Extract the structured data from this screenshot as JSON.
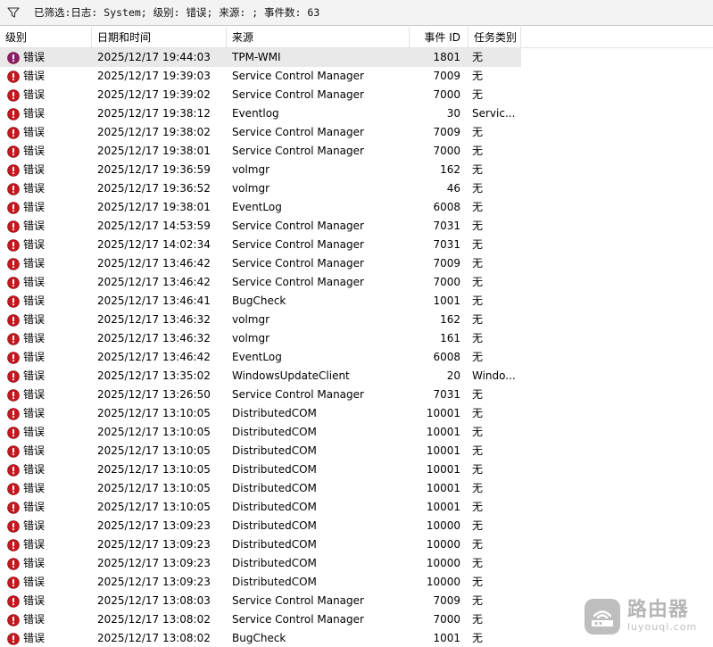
{
  "filter": {
    "text": "已筛选:日志: System; 级别: 错误; 来源: ; 事件数: 63",
    "icon": "filter-funnel-icon"
  },
  "columns": {
    "level": "级别",
    "date": "日期和时间",
    "source": "来源",
    "id": "事件 ID",
    "task": "任务类别"
  },
  "colors": {
    "error": "#c7161d",
    "selected_row": "#e9e9e9"
  },
  "level_label": "错误",
  "rows": [
    {
      "level": "错误",
      "date": "2025/12/17 19:44:03",
      "source": "TPM-WMI",
      "id": "1801",
      "task": "无"
    },
    {
      "level": "错误",
      "date": "2025/12/17 19:39:03",
      "source": "Service Control Manager",
      "id": "7009",
      "task": "无"
    },
    {
      "level": "错误",
      "date": "2025/12/17 19:39:02",
      "source": "Service Control Manager",
      "id": "7000",
      "task": "无"
    },
    {
      "level": "错误",
      "date": "2025/12/17 19:38:12",
      "source": "Eventlog",
      "id": "30",
      "task": "Servic..."
    },
    {
      "level": "错误",
      "date": "2025/12/17 19:38:02",
      "source": "Service Control Manager",
      "id": "7009",
      "task": "无"
    },
    {
      "level": "错误",
      "date": "2025/12/17 19:38:01",
      "source": "Service Control Manager",
      "id": "7000",
      "task": "无"
    },
    {
      "level": "错误",
      "date": "2025/12/17 19:36:59",
      "source": "volmgr",
      "id": "162",
      "task": "无"
    },
    {
      "level": "错误",
      "date": "2025/12/17 19:36:52",
      "source": "volmgr",
      "id": "46",
      "task": "无"
    },
    {
      "level": "错误",
      "date": "2025/12/17 19:38:01",
      "source": "EventLog",
      "id": "6008",
      "task": "无"
    },
    {
      "level": "错误",
      "date": "2025/12/17 14:53:59",
      "source": "Service Control Manager",
      "id": "7031",
      "task": "无"
    },
    {
      "level": "错误",
      "date": "2025/12/17 14:02:34",
      "source": "Service Control Manager",
      "id": "7031",
      "task": "无"
    },
    {
      "level": "错误",
      "date": "2025/12/17 13:46:42",
      "source": "Service Control Manager",
      "id": "7009",
      "task": "无"
    },
    {
      "level": "错误",
      "date": "2025/12/17 13:46:42",
      "source": "Service Control Manager",
      "id": "7000",
      "task": "无"
    },
    {
      "level": "错误",
      "date": "2025/12/17 13:46:41",
      "source": "BugCheck",
      "id": "1001",
      "task": "无"
    },
    {
      "level": "错误",
      "date": "2025/12/17 13:46:32",
      "source": "volmgr",
      "id": "162",
      "task": "无"
    },
    {
      "level": "错误",
      "date": "2025/12/17 13:46:32",
      "source": "volmgr",
      "id": "161",
      "task": "无"
    },
    {
      "level": "错误",
      "date": "2025/12/17 13:46:42",
      "source": "EventLog",
      "id": "6008",
      "task": "无"
    },
    {
      "level": "错误",
      "date": "2025/12/17 13:35:02",
      "source": "WindowsUpdateClient",
      "id": "20",
      "task": "Windo..."
    },
    {
      "level": "错误",
      "date": "2025/12/17 13:26:50",
      "source": "Service Control Manager",
      "id": "7031",
      "task": "无"
    },
    {
      "level": "错误",
      "date": "2025/12/17 13:10:05",
      "source": "DistributedCOM",
      "id": "10001",
      "task": "无"
    },
    {
      "level": "错误",
      "date": "2025/12/17 13:10:05",
      "source": "DistributedCOM",
      "id": "10001",
      "task": "无"
    },
    {
      "level": "错误",
      "date": "2025/12/17 13:10:05",
      "source": "DistributedCOM",
      "id": "10001",
      "task": "无"
    },
    {
      "level": "错误",
      "date": "2025/12/17 13:10:05",
      "source": "DistributedCOM",
      "id": "10001",
      "task": "无"
    },
    {
      "level": "错误",
      "date": "2025/12/17 13:10:05",
      "source": "DistributedCOM",
      "id": "10001",
      "task": "无"
    },
    {
      "level": "错误",
      "date": "2025/12/17 13:10:05",
      "source": "DistributedCOM",
      "id": "10001",
      "task": "无"
    },
    {
      "level": "错误",
      "date": "2025/12/17 13:09:23",
      "source": "DistributedCOM",
      "id": "10000",
      "task": "无"
    },
    {
      "level": "错误",
      "date": "2025/12/17 13:09:23",
      "source": "DistributedCOM",
      "id": "10000",
      "task": "无"
    },
    {
      "level": "错误",
      "date": "2025/12/17 13:09:23",
      "source": "DistributedCOM",
      "id": "10000",
      "task": "无"
    },
    {
      "level": "错误",
      "date": "2025/12/17 13:09:23",
      "source": "DistributedCOM",
      "id": "10000",
      "task": "无"
    },
    {
      "level": "错误",
      "date": "2025/12/17 13:08:03",
      "source": "Service Control Manager",
      "id": "7009",
      "task": "无"
    },
    {
      "level": "错误",
      "date": "2025/12/17 13:08:02",
      "source": "Service Control Manager",
      "id": "7000",
      "task": "无"
    },
    {
      "level": "错误",
      "date": "2025/12/17 13:08:02",
      "source": "BugCheck",
      "id": "1001",
      "task": "无"
    }
  ],
  "watermark": {
    "cn": "路由器",
    "en": "luyouqi.com",
    "icon": "router-logo-icon"
  }
}
